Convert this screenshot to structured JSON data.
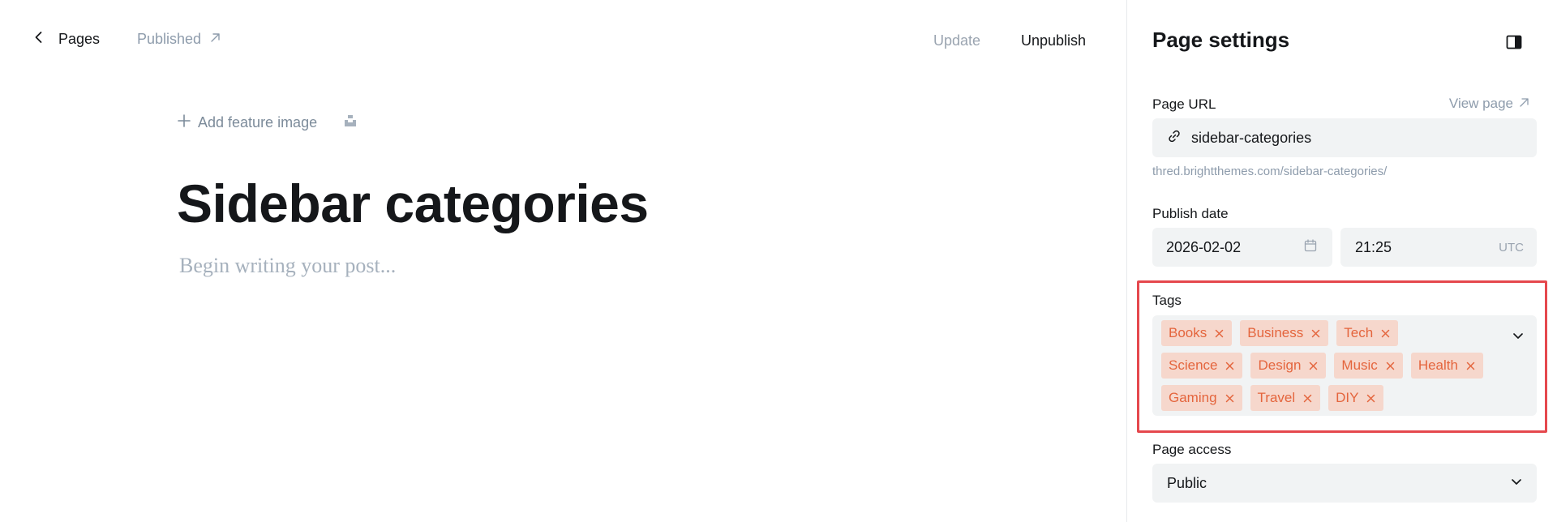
{
  "topbar": {
    "back_label": "Pages",
    "published_label": "Published",
    "update_label": "Update",
    "unpublish_label": "Unpublish"
  },
  "editor": {
    "add_feature_image_label": "Add feature image",
    "title": "Sidebar categories",
    "body_placeholder": "Begin writing your post..."
  },
  "settings": {
    "title": "Page settings",
    "page_url": {
      "label": "Page URL",
      "view_page_label": "View page",
      "value": "sidebar-categories",
      "hint": "thred.brightthemes.com/sidebar-categories/"
    },
    "publish_date": {
      "label": "Publish date",
      "date": "2026-02-02",
      "time": "21:25",
      "timezone": "UTC"
    },
    "tags": {
      "label": "Tags",
      "items": [
        "Books",
        "Business",
        "Tech",
        "Science",
        "Design",
        "Music",
        "Health",
        "Gaming",
        "Travel",
        "DIY"
      ]
    },
    "page_access": {
      "label": "Page access",
      "value": "Public"
    }
  },
  "colors": {
    "tag_bg": "#f6d7cc",
    "tag_text": "#e4653d",
    "highlight": "#e5484d",
    "input_bg": "#f1f3f4"
  },
  "icons": [
    "chevron-left-icon",
    "arrow-up-right-icon",
    "plus-icon",
    "unsplash-icon",
    "sidebar-toggle-icon",
    "link-icon",
    "calendar-icon",
    "close-icon",
    "chevron-down-icon"
  ]
}
